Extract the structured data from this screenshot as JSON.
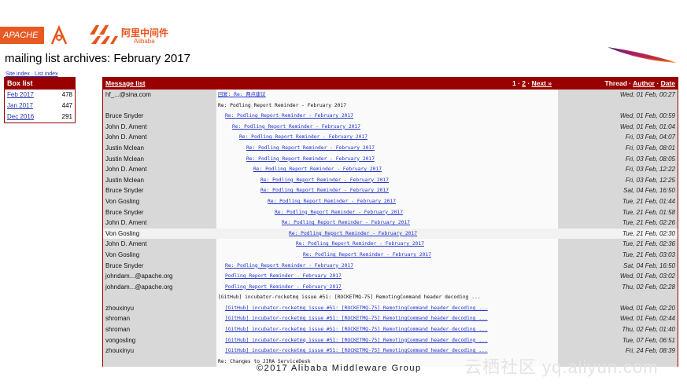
{
  "logos": {
    "apache": "APACHE",
    "ali_cn": "阿里中间件",
    "ali_en": "Alibaba"
  },
  "page_title": "mailing list archives: February 2017",
  "subnav": {
    "site_index": "Site index",
    "sep": " · ",
    "list_index": "List index"
  },
  "box": {
    "header": "Box list",
    "items": [
      {
        "month": "Feb 2017",
        "count": "478"
      },
      {
        "month": "Jan 2017",
        "count": "447"
      },
      {
        "month": "Dec 2016",
        "count": "291"
      }
    ]
  },
  "main": {
    "header": {
      "message_list": "Message list",
      "page1": "1",
      "sep": " · ",
      "page2": "2",
      "next": "Next »",
      "thread": "Thread",
      "author": "Author",
      "date": "Date"
    },
    "rows": [
      {
        "author": "hf_...@sina.com",
        "subject": "回复: Re: 两点建议",
        "indent": 0,
        "link": true,
        "date": "Wed, 01 Feb, 00:27"
      },
      {
        "author": "",
        "subject": "Re: Podling Report Reminder - February 2017",
        "indent": 0,
        "link": false,
        "date": ""
      },
      {
        "author": "Bruce Snyder",
        "subject": "Re: Podling Report Reminder - February 2017",
        "indent": 1,
        "link": true,
        "date": "Wed, 01 Feb, 00:59"
      },
      {
        "author": "John D. Ament",
        "subject": "Re: Podling Report Reminder - February 2017",
        "indent": 2,
        "link": true,
        "date": "Wed, 01 Feb, 01:04"
      },
      {
        "author": "John D. Ament",
        "subject": "Re: Podling Report Reminder - February 2017",
        "indent": 3,
        "link": true,
        "date": "Fri, 03 Feb, 04:07"
      },
      {
        "author": "Justin Mclean",
        "subject": "Re: Podling Report Reminder - February 2017",
        "indent": 4,
        "link": true,
        "date": "Fri, 03 Feb, 08:01"
      },
      {
        "author": "Justin Mclean",
        "subject": "Re: Podling Report Reminder - February 2017",
        "indent": 4,
        "link": true,
        "date": "Fri, 03 Feb, 08:05"
      },
      {
        "author": "John D. Ament",
        "subject": "Re: Podling Report Reminder - February 2017",
        "indent": 5,
        "link": true,
        "date": "Fri, 03 Feb, 12:22"
      },
      {
        "author": "Justin Mclean",
        "subject": "Re: Podling Report Reminder - February 2017",
        "indent": 6,
        "link": true,
        "date": "Fri, 03 Feb, 12:25"
      },
      {
        "author": "Bruce Snyder",
        "subject": "Re: Podling Report Reminder - February 2017",
        "indent": 6,
        "link": true,
        "date": "Sat, 04 Feb, 16:50"
      },
      {
        "author": "Von Gosling",
        "subject": "Re: Podling Report Reminder - February 2017",
        "indent": 7,
        "link": true,
        "date": "Tue, 21 Feb, 01:44"
      },
      {
        "author": "Bruce Snyder",
        "subject": "Re: Podling Report Reminder - February 2017",
        "indent": 8,
        "link": true,
        "date": "Tue, 21 Feb, 01:58"
      },
      {
        "author": "John D. Ament",
        "subject": "Re: Podling Report Reminder - February 2017",
        "indent": 9,
        "link": true,
        "date": "Tue, 21 Feb, 02:26"
      },
      {
        "author": "Von Gosling",
        "subject": "Re: Podling Report Reminder - February 2017",
        "indent": 10,
        "link": true,
        "date": "Tue, 21 Feb, 02:30",
        "highlight": true
      },
      {
        "author": "John D. Ament",
        "subject": "Re: Podling Report Reminder - February 2017",
        "indent": 11,
        "link": true,
        "date": "Tue, 21 Feb, 02:36"
      },
      {
        "author": "Von Gosling",
        "subject": "Re: Podling Report Reminder - February 2017",
        "indent": 12,
        "link": true,
        "date": "Tue, 21 Feb, 03:03"
      },
      {
        "author": "Bruce Snyder",
        "subject": "Re: Podling Report Reminder - February 2017",
        "indent": 1,
        "link": true,
        "date": "Sat, 04 Feb, 16:50"
      },
      {
        "author": "johndam...@apache.org",
        "subject": "Podling Report Reminder - February 2017",
        "indent": 1,
        "link": true,
        "date": "Wed, 01 Feb, 03:02"
      },
      {
        "author": "johndam...@apache.org",
        "subject": "Podling Report Reminder - February 2017",
        "indent": 1,
        "link": true,
        "date": "Thu, 02 Feb, 02:28"
      },
      {
        "author": "",
        "subject": "[GitHub] incubator-rocketmq issue #51: [ROCKETMQ-75] RemotingCommand header decoding ...",
        "indent": 0,
        "link": false,
        "date": ""
      },
      {
        "author": "zhouxinyu",
        "subject": "[GitHub] incubator-rocketmq issue #51: [ROCKETMQ-75] RemotingCommand header decoding ...",
        "indent": 1,
        "link": true,
        "date": "Wed, 01 Feb, 02:20"
      },
      {
        "author": "shroman",
        "subject": "[GitHub] incubator-rocketmq issue #51: [ROCKETMQ-75] RemotingCommand header decoding ...",
        "indent": 1,
        "link": true,
        "date": "Wed, 01 Feb, 02:44"
      },
      {
        "author": "shroman",
        "subject": "[GitHub] incubator-rocketmq issue #51: [ROCKETMQ-75] RemotingCommand header decoding ...",
        "indent": 1,
        "link": true,
        "date": "Thu, 02 Feb, 01:40"
      },
      {
        "author": "vongosling",
        "subject": "[GitHub] incubator-rocketmq issue #51: [ROCKETMQ-75] RemotingCommand header decoding ...",
        "indent": 1,
        "link": true,
        "date": "Tue, 07 Feb, 06:51"
      },
      {
        "author": "zhouxinyu",
        "subject": "[GitHub] incubator-rocketmq issue #51: [ROCKETMQ-75] RemotingCommand header decoding ...",
        "indent": 1,
        "link": true,
        "date": "Fri, 24 Feb, 08:39"
      },
      {
        "author": "",
        "subject": "Re: Changes to JIRA ServiceDesk",
        "indent": 0,
        "link": false,
        "date": ""
      }
    ]
  },
  "footer": "©2017 Alibaba Middleware Group",
  "watermark": "云栖社区 yq.aliyun.com"
}
